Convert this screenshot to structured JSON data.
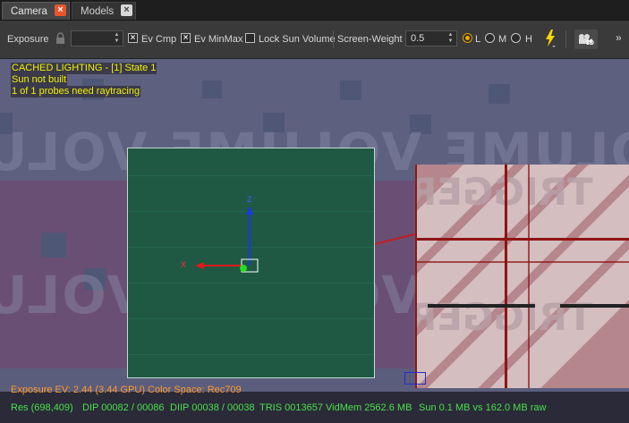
{
  "tabs": [
    {
      "label": "Camera",
      "close": "×"
    },
    {
      "label": "Models",
      "close": "×"
    }
  ],
  "toolbar": {
    "exposure_label": "Exposure",
    "exposure_value": "",
    "ev_cmp_label": "Ev Cmp",
    "ev_cmp_checked": true,
    "ev_minmax_label": "Ev MinMax",
    "ev_minmax_checked": true,
    "lock_sun_label": "Lock Sun Volume",
    "lock_sun_checked": false,
    "screen_weight_label": "Screen-Weight",
    "screen_weight_value": "0.5",
    "quality_options": [
      {
        "label": "L",
        "selected": true
      },
      {
        "label": "M",
        "selected": false
      },
      {
        "label": "H",
        "selected": false
      }
    ],
    "camera_3d_label": "3D",
    "overflow_glyph": "»",
    "icons": [
      "lock-icon",
      "lightning-icon",
      "camera-3d-icon"
    ]
  },
  "overlay": {
    "lines": [
      "CACHED LIGHTING - [1] State 1",
      "Sun not built",
      "1 of 1 probes need raytracing"
    ]
  },
  "scene": {
    "wall_text": "VOLUME VOLUME VOLUME VOLUME",
    "trigger_text": "TRIGGER",
    "gizmo": {
      "x_label": "X",
      "z_label": "Z"
    }
  },
  "status": {
    "exposure": "Exposure EV: 2.44 (3.44 GPU)  Color Space: Rec709",
    "res": "Res (698,409)",
    "dip": "DIP 00082 / 00086",
    "diip": "DIIP 00038 / 00038",
    "tris": "TRIS 0013657",
    "vidmem": "VidMem 2562.6 MB",
    "sun": "Sun 0.1 MB vs 162.0 MB raw"
  },
  "colors": {
    "accent": "#e9542c",
    "overlay_text": "#f2f000",
    "status_orange": "#ff9a2a",
    "status_green": "#4ae04a"
  }
}
